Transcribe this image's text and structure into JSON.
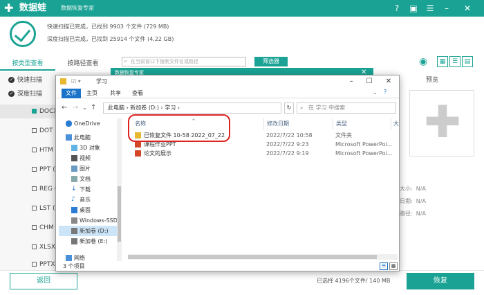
{
  "app": {
    "title": "数据蛙",
    "subtitle": "数据恢复专家"
  },
  "scan": {
    "quick": "快速扫描已完成，已找到 9903 个文件 (729 MB)",
    "deep": "深度扫描已完成，已找到 25914 个文件 (4.22 GB)"
  },
  "tabs": {
    "by_type": "按类型查看",
    "by_path": "按路径查看"
  },
  "search": {
    "placeholder": "在当前窗口下搜索文件名或路径"
  },
  "filter_label": "筛选器",
  "sidebar": {
    "quick_scan": "快速扫描",
    "deep_scan": "深度扫描",
    "types": [
      "DOCX (",
      "DOT (",
      "HTM (",
      "PPT (7",
      "REG (",
      "LST (2",
      "CHM (",
      "XLSX (",
      "PPTX ("
    ]
  },
  "preview": {
    "title": "预览",
    "meta": [
      {
        "label": "大小:",
        "value": "N/A"
      },
      {
        "label": "日期:",
        "value": "N/A"
      },
      {
        "label": "路径:",
        "value": "N/A"
      }
    ]
  },
  "behind_dialog_title": "数据恢复专家",
  "explorer": {
    "title": "学习",
    "ribbon": [
      "文件",
      "主页",
      "共享",
      "查看"
    ],
    "address": [
      "此电脑",
      "新加卷 (D:)",
      "学习"
    ],
    "search_placeholder": "在 学习 中搜索",
    "nav": [
      "OneDrive",
      "此电脑",
      "3D 对象",
      "视频",
      "图片",
      "文档",
      "下载",
      "音乐",
      "桌面",
      "Windows-SSD (",
      "新加卷 (D:)",
      "新加卷 (E:)",
      "网络"
    ],
    "columns": {
      "name": "名称",
      "modified": "修改日期",
      "type": "类型",
      "size": "大"
    },
    "files": [
      {
        "name": "已恢复文件 10-58 2022_07_22",
        "date": "2022/7/22 10:58",
        "type": "文件夹"
      },
      {
        "name": "课程作业PPT",
        "date": "2022/7/22 9:23",
        "type": "Microsoft PowerPoi..."
      },
      {
        "name": "论文的展示",
        "date": "2022/7/22 9:19",
        "type": "Microsoft PowerPoi..."
      }
    ],
    "status": "3 个项目"
  },
  "footer": {
    "back": "返回",
    "selected": "已选择 4196个文件/ 140 MB",
    "recover": "恢复"
  },
  "colors": {
    "accent": "#1aa394",
    "ribbon_file": "#1a73c8",
    "highlight": "#dd2222"
  }
}
